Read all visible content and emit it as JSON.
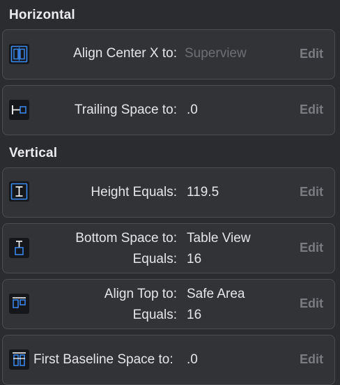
{
  "sections": {
    "horizontal_title": "Horizontal",
    "vertical_title": "Vertical"
  },
  "constraints": [
    {
      "label": "Align Center X to:",
      "value": "Superview",
      "value_placeholder": true,
      "edit": "Edit",
      "icon": "align-center-x-icon"
    },
    {
      "label": "Trailing Space to:",
      "value": ".0",
      "edit": "Edit",
      "icon": "trailing-space-icon"
    },
    {
      "label": "Height Equals:",
      "value": "119.5",
      "edit": "Edit",
      "icon": "height-icon"
    },
    {
      "label": "Bottom Space to:",
      "value": "Table View",
      "label2": "Equals:",
      "value2": "16",
      "edit": "Edit",
      "icon": "bottom-space-icon"
    },
    {
      "label": "Align Top to:",
      "value": "Safe Area",
      "label2": "Equals:",
      "value2": "16",
      "edit": "Edit",
      "icon": "align-top-icon"
    },
    {
      "label": "First Baseline Space to:",
      "value": ".0",
      "edit": "Edit",
      "icon": "first-baseline-icon"
    }
  ],
  "colors": {
    "background": "#2b2c30",
    "card": "#323337",
    "accent_icon": "#3b8cf7",
    "placeholder": "#6e6f74"
  }
}
